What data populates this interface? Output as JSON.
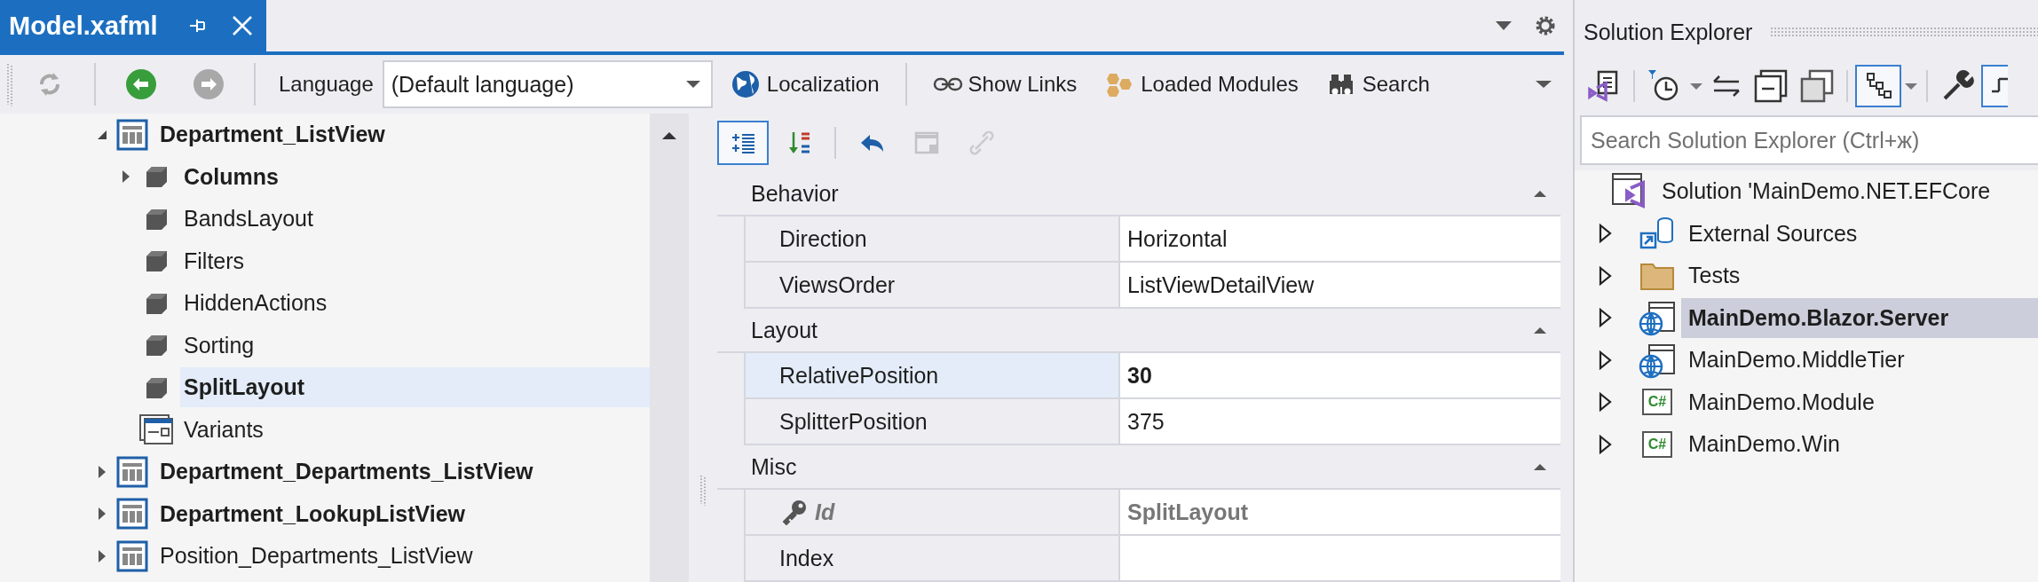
{
  "document_tab": {
    "title": "Model.xafml",
    "selected": true
  },
  "toolbar": {
    "nav": [
      {
        "kind": "refresh",
        "disabled": true
      },
      {
        "kind": "back",
        "disabled": false
      },
      {
        "kind": "forward",
        "disabled": true
      }
    ],
    "language_label": "Language",
    "language_value": "(Default language)",
    "actions": [
      {
        "kind": "globe",
        "label": "Localization"
      },
      {
        "kind": "links",
        "label": "Show Links"
      },
      {
        "kind": "modules",
        "label": "Loaded Modules"
      },
      {
        "kind": "binoculars",
        "label": "Search"
      }
    ]
  },
  "tree": {
    "items": [
      {
        "label": "Department_ListView",
        "bold": true,
        "expanded": true,
        "kind": "listview",
        "selected": false,
        "children": [
          {
            "label": "Columns",
            "bold": true,
            "expanded": false,
            "kind": "node",
            "selected": false
          },
          {
            "label": "BandsLayout",
            "bold": false,
            "kind": "node",
            "selected": false
          },
          {
            "label": "Filters",
            "bold": false,
            "kind": "node",
            "selected": false
          },
          {
            "label": "HiddenActions",
            "bold": false,
            "kind": "node",
            "selected": false
          },
          {
            "label": "Sorting",
            "bold": false,
            "kind": "node",
            "selected": false
          },
          {
            "label": "SplitLayout",
            "bold": true,
            "kind": "node",
            "selected": true
          },
          {
            "label": "Variants",
            "bold": false,
            "kind": "variants",
            "selected": false
          }
        ]
      },
      {
        "label": "Department_Departments_ListView",
        "bold": true,
        "expanded": false,
        "kind": "listview",
        "selected": false
      },
      {
        "label": "Department_LookupListView",
        "bold": true,
        "expanded": false,
        "kind": "listview",
        "selected": false
      },
      {
        "label": "Position_Departments_ListView",
        "bold": false,
        "expanded": false,
        "kind": "listview",
        "selected": false
      }
    ]
  },
  "property_grid": {
    "tools": [
      {
        "kind": "categorized",
        "selected": true,
        "disabled": false
      },
      {
        "kind": "alphabetical",
        "selected": false,
        "disabled": false
      },
      {
        "kind": "undo",
        "selected": false,
        "disabled": false
      },
      {
        "kind": "window",
        "selected": false,
        "disabled": true
      },
      {
        "kind": "link",
        "selected": false,
        "disabled": true
      }
    ],
    "categories": [
      {
        "name": "Behavior",
        "expanded": true,
        "rows": [
          {
            "kind": "plain",
            "name": "Direction",
            "value": "Horizontal",
            "selected": false,
            "modified": false
          },
          {
            "kind": "plain",
            "name": "ViewsOrder",
            "value": "ListViewDetailView",
            "selected": false,
            "modified": false
          }
        ]
      },
      {
        "name": "Layout",
        "expanded": true,
        "rows": [
          {
            "kind": "plain",
            "name": "RelativePosition",
            "value": "30",
            "selected": true,
            "modified": true
          },
          {
            "kind": "plain",
            "name": "SplitterPosition",
            "value": "375",
            "selected": false,
            "modified": false
          }
        ]
      },
      {
        "name": "Misc",
        "expanded": true,
        "rows": [
          {
            "kind": "key",
            "name": "Id",
            "value": "SplitLayout",
            "selected": false,
            "modified": false
          },
          {
            "kind": "plain",
            "name": "Index",
            "selected": false,
            "modified": false
          }
        ]
      }
    ]
  },
  "solution_explorer": {
    "title": "Solution Explorer",
    "search": {
      "placeholder": "Search Solution Explorer (Ctrl+ж)"
    },
    "tools": [
      {
        "kind": "vs-doc",
        "selected": false
      },
      {
        "kind": "history",
        "selected": false
      },
      {
        "kind": "caret",
        "selected": false
      },
      {
        "kind": "sync",
        "selected": false
      },
      {
        "kind": "collapse",
        "selected": false
      },
      {
        "kind": "copies",
        "selected": false
      },
      {
        "kind": "hierarchy",
        "selected": true
      },
      {
        "kind": "caret",
        "selected": false
      },
      {
        "kind": "wrench",
        "selected": false
      },
      {
        "kind": "preview",
        "selected": true
      }
    ],
    "items": [
      {
        "label": "Solution 'MainDemo.NET.EFCore",
        "bold": false,
        "kind": "solution",
        "selected": false,
        "children": [
          {
            "label": "External Sources",
            "bold": false,
            "expanded": false,
            "kind": "external",
            "selected": false
          },
          {
            "label": "Tests",
            "bold": false,
            "expanded": false,
            "kind": "folder",
            "selected": false
          },
          {
            "label": "MainDemo.Blazor.Server",
            "bold": true,
            "expanded": false,
            "kind": "web",
            "selected": true
          },
          {
            "label": "MainDemo.MiddleTier",
            "bold": false,
            "expanded": false,
            "kind": "web",
            "selected": false
          },
          {
            "label": "MainDemo.Module",
            "bold": false,
            "expanded": false,
            "kind": "csharp",
            "icon_text": "C#",
            "selected": false
          },
          {
            "label": "MainDemo.Win",
            "bold": false,
            "expanded": false,
            "kind": "csharp",
            "icon_text": "C#",
            "selected": false
          }
        ]
      }
    ]
  }
}
